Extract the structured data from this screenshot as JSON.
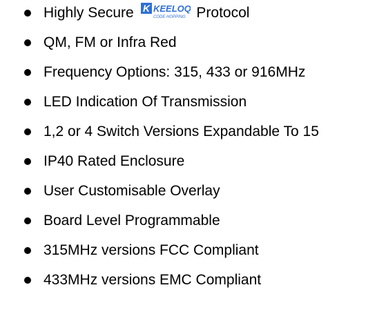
{
  "features": [
    {
      "before": "Highly Secure",
      "after": "Protocol",
      "logo": "keeloq-logo"
    },
    {
      "text": "QM, FM or Infra Red"
    },
    {
      "text": "Frequency Options: 315, 433 or 916MHz"
    },
    {
      "text": "LED Indication Of Transmission"
    },
    {
      "text": "1,2 or 4 Switch Versions Expandable To 15"
    },
    {
      "text": "IP40 Rated Enclosure"
    },
    {
      "text": "User Customisable Overlay"
    },
    {
      "text": "Board Level Programmable"
    },
    {
      "text": "315MHz versions FCC Compliant"
    },
    {
      "text": "433MHz versions EMC Compliant"
    }
  ],
  "logo": {
    "mark": "K",
    "wordmark": "KEELOQ",
    "tagline": "CODE HOPPING",
    "color": "#2f6fd6"
  }
}
